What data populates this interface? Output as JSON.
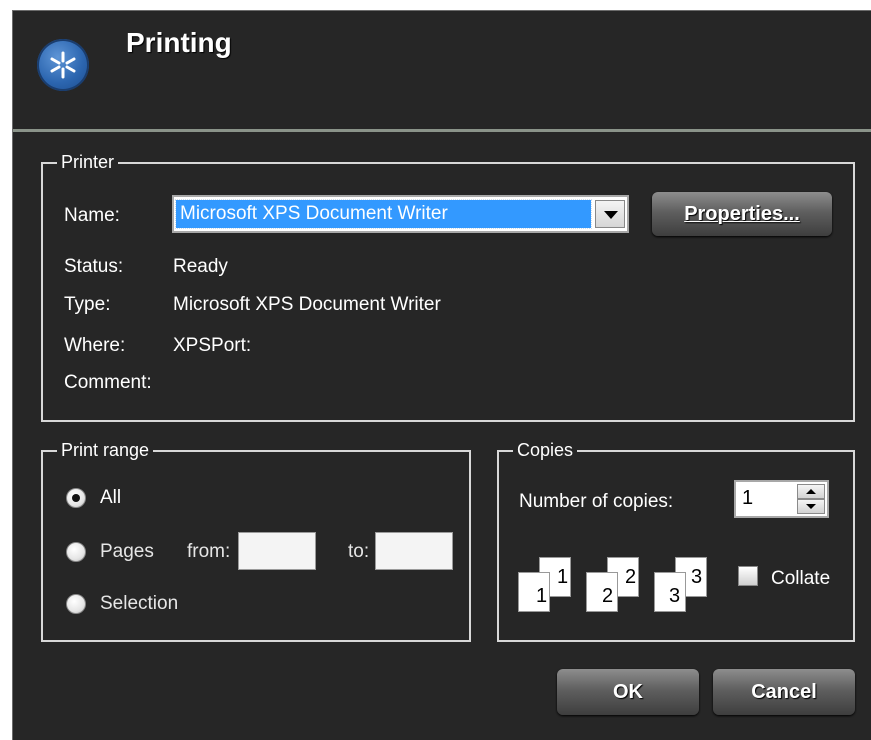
{
  "dialog": {
    "title": "Printing"
  },
  "printer": {
    "legend": "Printer",
    "name_label": "Name:",
    "selected": "Microsoft XPS Document Writer",
    "properties_button": "Properties...",
    "status_label": "Status:",
    "status_value": "Ready",
    "type_label": "Type:",
    "type_value": "Microsoft XPS Document Writer",
    "where_label": "Where:",
    "where_value": "XPSPort:",
    "comment_label": "Comment:",
    "comment_value": ""
  },
  "print_range": {
    "legend": "Print range",
    "all_label": "All",
    "pages_label": "Pages",
    "from_label": "from:",
    "from_value": "",
    "to_label": "to:",
    "to_value": "",
    "selection_label": "Selection",
    "selected_option": "All"
  },
  "copies": {
    "legend": "Copies",
    "number_label": "Number of copies:",
    "number_value": "1",
    "collate_label": "Collate",
    "collate_checked": false,
    "pages_illustration": [
      {
        "back": "1",
        "front": "1"
      },
      {
        "back": "2",
        "front": "2"
      },
      {
        "back": "3",
        "front": "3"
      }
    ]
  },
  "buttons": {
    "ok": "OK",
    "cancel": "Cancel"
  },
  "colors": {
    "background": "#262626",
    "selection": "#3399ff",
    "header_line": "#8a9389"
  }
}
